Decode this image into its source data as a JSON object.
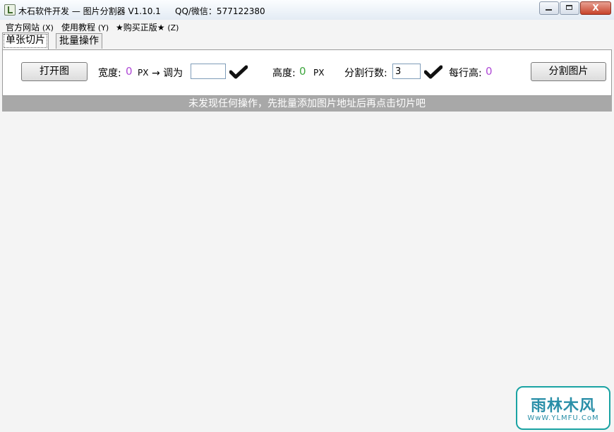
{
  "window": {
    "title": "木石软件开发 — 图片分割器 V1.10.1",
    "qq": "QQ/微信：577122380",
    "close_glyph": "X"
  },
  "menu": [
    {
      "label": "官方网站",
      "hotkey": "(X)"
    },
    {
      "label": "使用教程",
      "hotkey": "(Y)"
    },
    {
      "label": "★购买正版★",
      "hotkey": "(Z)"
    }
  ],
  "tabs": [
    {
      "label": "单张切片",
      "active": true
    },
    {
      "label": "批量操作",
      "active": false
    }
  ],
  "toolbar": {
    "open_button": "打开图",
    "width_label": "宽度:",
    "width_value": "0",
    "px_unit": "PX",
    "arrow_label": "→ 调为",
    "width_input_value": "",
    "height_label": "高度:",
    "height_value": "0",
    "height_unit": "PX",
    "rows_label": "分割行数:",
    "rows_input_value": "3",
    "row_height_label": "每行高:",
    "row_height_value": "0",
    "split_button": "分割图片"
  },
  "status": {
    "message": "未发现任何操作，先批量添加图片地址后再点击切片吧"
  },
  "watermark": {
    "main": "雨林木风",
    "sub": "WwW.YLMFU.CoM"
  },
  "colors": {
    "status_bg": "#a8a8a8",
    "purple_value": "#b04bd6",
    "green_value": "#3fa63f"
  }
}
